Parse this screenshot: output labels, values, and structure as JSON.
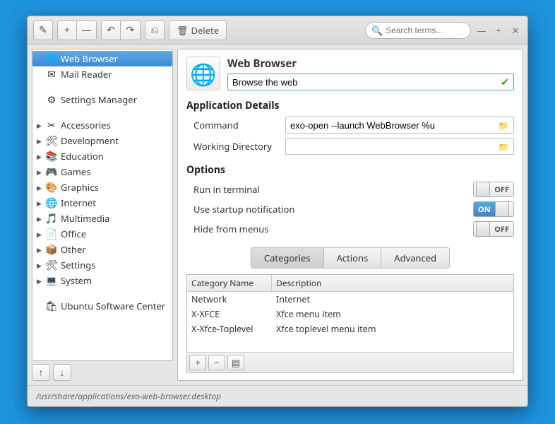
{
  "toolbar": {
    "delete_label": "Delete",
    "search_placeholder": "Search terms..."
  },
  "sidebar": {
    "items": [
      {
        "label": "Web Browser",
        "selected": true,
        "expandable": false,
        "icon": "🌐"
      },
      {
        "label": "Mail Reader",
        "selected": false,
        "expandable": false,
        "icon": "✉"
      },
      {
        "spacer": true
      },
      {
        "label": "Settings Manager",
        "selected": false,
        "expandable": false,
        "icon": "⚙"
      },
      {
        "spacer": true
      },
      {
        "label": "Accessories",
        "selected": false,
        "expandable": true,
        "icon": "✂"
      },
      {
        "label": "Development",
        "selected": false,
        "expandable": true,
        "icon": "🛠"
      },
      {
        "label": "Education",
        "selected": false,
        "expandable": true,
        "icon": "📚"
      },
      {
        "label": "Games",
        "selected": false,
        "expandable": true,
        "icon": "🎮"
      },
      {
        "label": "Graphics",
        "selected": false,
        "expandable": true,
        "icon": "🎨"
      },
      {
        "label": "Internet",
        "selected": false,
        "expandable": true,
        "icon": "🌐"
      },
      {
        "label": "Multimedia",
        "selected": false,
        "expandable": true,
        "icon": "🎵"
      },
      {
        "label": "Office",
        "selected": false,
        "expandable": true,
        "icon": "📄"
      },
      {
        "label": "Other",
        "selected": false,
        "expandable": true,
        "icon": "📦"
      },
      {
        "label": "Settings",
        "selected": false,
        "expandable": true,
        "icon": "🛠"
      },
      {
        "label": "System",
        "selected": false,
        "expandable": true,
        "icon": "💻"
      },
      {
        "spacer": true
      },
      {
        "label": "Ubuntu Software Center",
        "selected": false,
        "expandable": false,
        "icon": "🛍"
      }
    ]
  },
  "main": {
    "title": "Web Browser",
    "name_value": "Browse the web",
    "section_app_details": "Application Details",
    "command_label": "Command",
    "command_value": "exo-open --launch WebBrowser %u",
    "workdir_label": "Working Directory",
    "workdir_value": "",
    "section_options": "Options",
    "opt_terminal_label": "Run in terminal",
    "opt_terminal_state": "OFF",
    "opt_startup_label": "Use startup notification",
    "opt_startup_state": "ON",
    "opt_hide_label": "Hide from menus",
    "opt_hide_state": "OFF",
    "tabs": [
      "Categories",
      "Actions",
      "Advanced"
    ],
    "active_tab": 0,
    "cat_head_name": "Category Name",
    "cat_head_desc": "Description",
    "categories": [
      {
        "name": "Network",
        "desc": "Internet"
      },
      {
        "name": "X-XFCE",
        "desc": "Xfce menu item"
      },
      {
        "name": "X-Xfce-Toplevel",
        "desc": "Xfce toplevel menu item"
      }
    ]
  },
  "footer_path": "/usr/share/applications/exo-web-browser.desktop"
}
